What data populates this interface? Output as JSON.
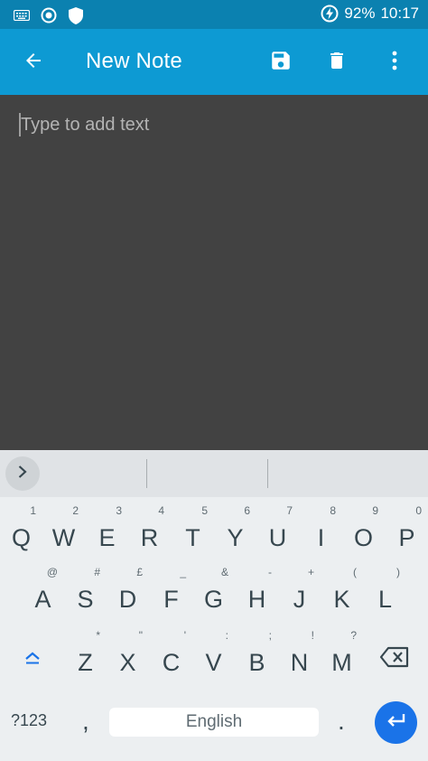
{
  "status_bar": {
    "icons": [
      "keyboard-icon",
      "record-icon",
      "shield-icon",
      "battery-charging-icon"
    ],
    "battery": "92%",
    "time": "10:17"
  },
  "app_bar": {
    "title": "New Note",
    "actions": [
      "back-arrow-icon",
      "save-icon",
      "delete-icon",
      "more-vert-icon"
    ]
  },
  "editor": {
    "placeholder": "Type to add text"
  },
  "keyboard": {
    "row1": [
      {
        "key": "Q",
        "hint": "1"
      },
      {
        "key": "W",
        "hint": "2"
      },
      {
        "key": "E",
        "hint": "3"
      },
      {
        "key": "R",
        "hint": "4"
      },
      {
        "key": "T",
        "hint": "5"
      },
      {
        "key": "Y",
        "hint": "6"
      },
      {
        "key": "U",
        "hint": "7"
      },
      {
        "key": "I",
        "hint": "8"
      },
      {
        "key": "O",
        "hint": "9"
      },
      {
        "key": "P",
        "hint": "0"
      }
    ],
    "row2": [
      {
        "key": "A",
        "hint": "@"
      },
      {
        "key": "S",
        "hint": "#"
      },
      {
        "key": "D",
        "hint": "£"
      },
      {
        "key": "F",
        "hint": "_"
      },
      {
        "key": "G",
        "hint": "&"
      },
      {
        "key": "H",
        "hint": "-"
      },
      {
        "key": "J",
        "hint": "+"
      },
      {
        "key": "K",
        "hint": "("
      },
      {
        "key": "L",
        "hint": ")"
      }
    ],
    "row3": [
      {
        "key": "Z",
        "hint": "*"
      },
      {
        "key": "X",
        "hint": "\""
      },
      {
        "key": "C",
        "hint": "'"
      },
      {
        "key": "V",
        "hint": ":"
      },
      {
        "key": "B",
        "hint": ";"
      },
      {
        "key": "N",
        "hint": "!"
      },
      {
        "key": "M",
        "hint": "?"
      }
    ],
    "symbols_label": "?123",
    "comma": ",",
    "space_label": "English",
    "period": ".",
    "accent_color": "#1a73e8"
  }
}
